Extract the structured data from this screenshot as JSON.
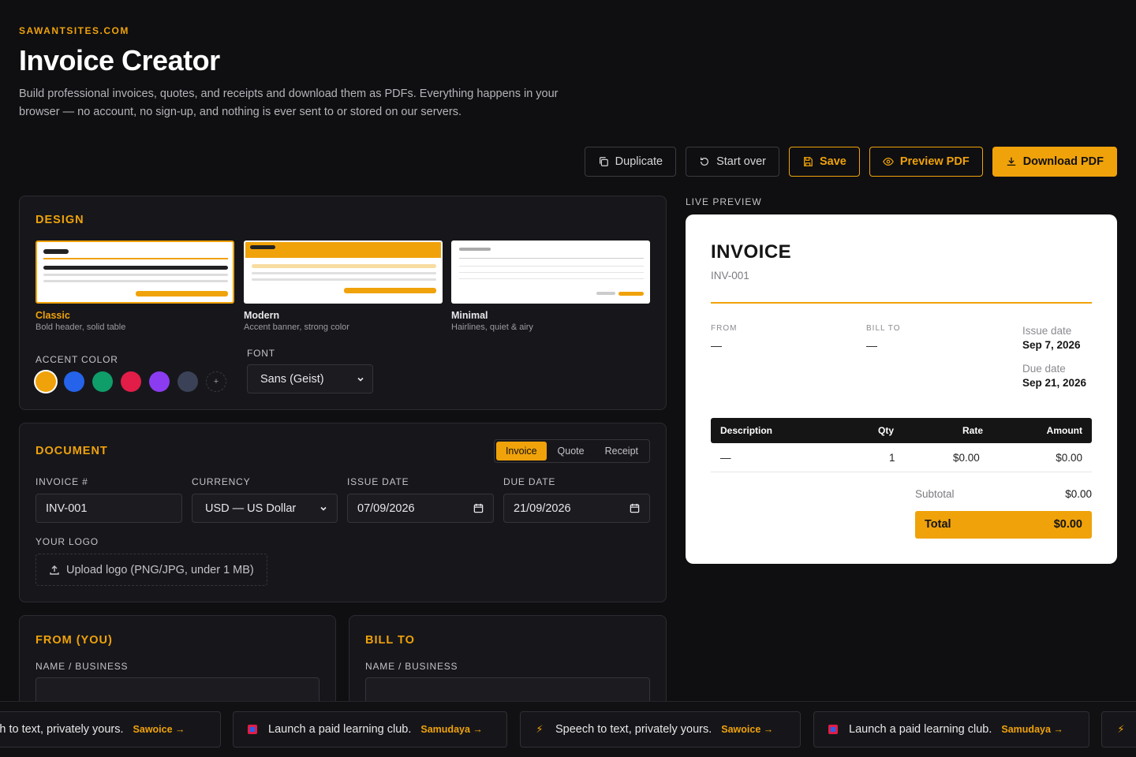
{
  "header": {
    "brand": "SAWANTSITES.COM",
    "title": "Invoice Creator",
    "intro": "Build professional invoices, quotes, and receipts and download them as PDFs. Everything happens in your browser — no account, no sign-up, and nothing is ever sent to or stored on our servers."
  },
  "toolbar": {
    "duplicate": "Duplicate",
    "start_over": "Start over",
    "save": "Save",
    "preview": "Preview PDF",
    "download": "Download PDF"
  },
  "design": {
    "title": "DESIGN",
    "templates": [
      {
        "name": "Classic",
        "desc": "Bold header, solid table"
      },
      {
        "name": "Modern",
        "desc": "Accent banner, strong color"
      },
      {
        "name": "Minimal",
        "desc": "Hairlines, quiet & airy"
      }
    ],
    "accent_label": "ACCENT COLOR",
    "accent_colors": [
      "#f0a20a",
      "#2563eb",
      "#0f9d6a",
      "#e11d48",
      "#8b3cf0",
      "#3b4257"
    ],
    "add_color": "+",
    "font_label": "FONT",
    "font_value": "Sans (Geist)"
  },
  "document": {
    "title": "DOCUMENT",
    "types": [
      "Invoice",
      "Quote",
      "Receipt"
    ],
    "invoice_label": "INVOICE #",
    "invoice_value": "INV-001",
    "currency_label": "CURRENCY",
    "currency_value": "USD — US Dollar",
    "issue_label": "ISSUE DATE",
    "issue_value": "07/09/2026",
    "due_label": "DUE DATE",
    "due_value": "21/09/2026",
    "logo_label": "YOUR LOGO",
    "upload_text": "Upload logo (PNG/JPG, under 1 MB)"
  },
  "from": {
    "title": "FROM (YOU)",
    "name_label": "NAME / BUSINESS"
  },
  "bill": {
    "title": "BILL TO",
    "name_label": "NAME / BUSINESS"
  },
  "preview": {
    "label": "LIVE PREVIEW",
    "doc_title": "INVOICE",
    "number": "INV-001",
    "from_label": "FROM",
    "from_value": "—",
    "bill_label": "BILL TO",
    "bill_value": "—",
    "issue_label": "Issue date",
    "issue_value": "Sep 7, 2026",
    "due_label": "Due date",
    "due_value": "Sep 21, 2026",
    "columns": [
      "Description",
      "Qty",
      "Rate",
      "Amount"
    ],
    "row": {
      "description": "—",
      "qty": "1",
      "rate": "$0.00",
      "amount": "$0.00"
    },
    "subtotal_label": "Subtotal",
    "subtotal_value": "$0.00",
    "total_label": "Total",
    "total_value": "$0.00"
  },
  "ads": [
    {
      "text": "Speech to text, privately yours.",
      "cta": "Sawoice →",
      "visible_text": "eech to text, privately yours."
    },
    {
      "text": "Launch a paid learning club.",
      "cta": "Samudaya →"
    },
    {
      "text": "Speech to text, privately yours.",
      "cta": "Sawoice →"
    },
    {
      "text": "Launch a paid learning club.",
      "cta": "Samudaya →"
    }
  ]
}
